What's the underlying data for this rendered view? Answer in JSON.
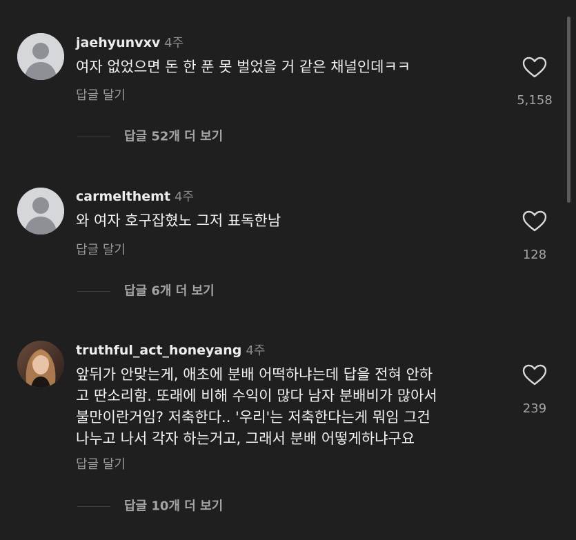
{
  "comments": [
    {
      "username": "jaehyunvxv",
      "time": "4주",
      "text": "여자 없었으면 돈 한 푼 못 벌었을 거 같은 채널인데ㅋㅋ",
      "reply_label": "답글 달기",
      "likes": "5,158",
      "view_replies": "답글 52개 더 보기",
      "avatar": "default-avatar"
    },
    {
      "username": "carmelthemt",
      "time": "4주",
      "text": "와 여자 호구잡혔노 그저 표독한남",
      "reply_label": "답글 달기",
      "likes": "128",
      "view_replies": "답글 6개 더 보기",
      "avatar": "default-avatar"
    },
    {
      "username": "truthful_act_honeyang",
      "time": "4주",
      "text": "앞뒤가 안맞는게, 애초에 분배 어떡하냐는데 답을 전혀 안하\n고 딴소리함. 또래에 비해 수익이 많다  남자 분배비가 많아서\n불만이란거임? 저축한다.. '우리'는 저축한다는게 뭐임 그건\n나누고 나서 각자 하는거고, 그래서 분배 어떻게하냐구요",
      "reply_label": "답글 달기",
      "likes": "239",
      "view_replies": "답글 10개 더 보기",
      "avatar": "photo-avatar"
    }
  ],
  "icons": {
    "like": "heart-outline-icon",
    "default_avatar": "person-silhouette-icon"
  },
  "colors": {
    "background": "#1f1f20",
    "text": "#f1f1f1",
    "muted": "#9a9a9a"
  }
}
